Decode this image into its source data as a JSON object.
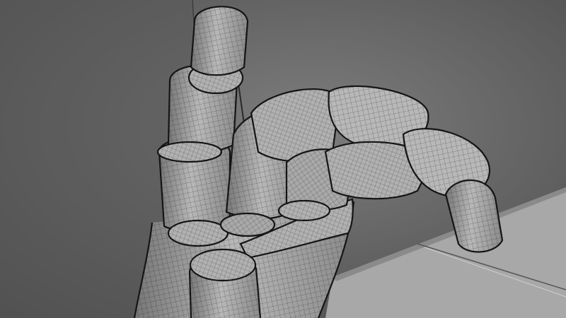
{
  "scene": {
    "subject": "",
    "colors": {
      "background_dark": "#4a4a4a",
      "background_mid": "#6f6f6f",
      "wall_light": "#8c8c8c",
      "floor_light": "#a9a9a9",
      "mesh_surface": "#b5b5b5",
      "mesh_line": "#202020"
    },
    "elements": [
      "wireframe-hand",
      "index-finger",
      "middle-finger",
      "ring-finger",
      "pinky-finger",
      "thumb",
      "palm",
      "floor-plane",
      "wall-plane"
    ]
  }
}
